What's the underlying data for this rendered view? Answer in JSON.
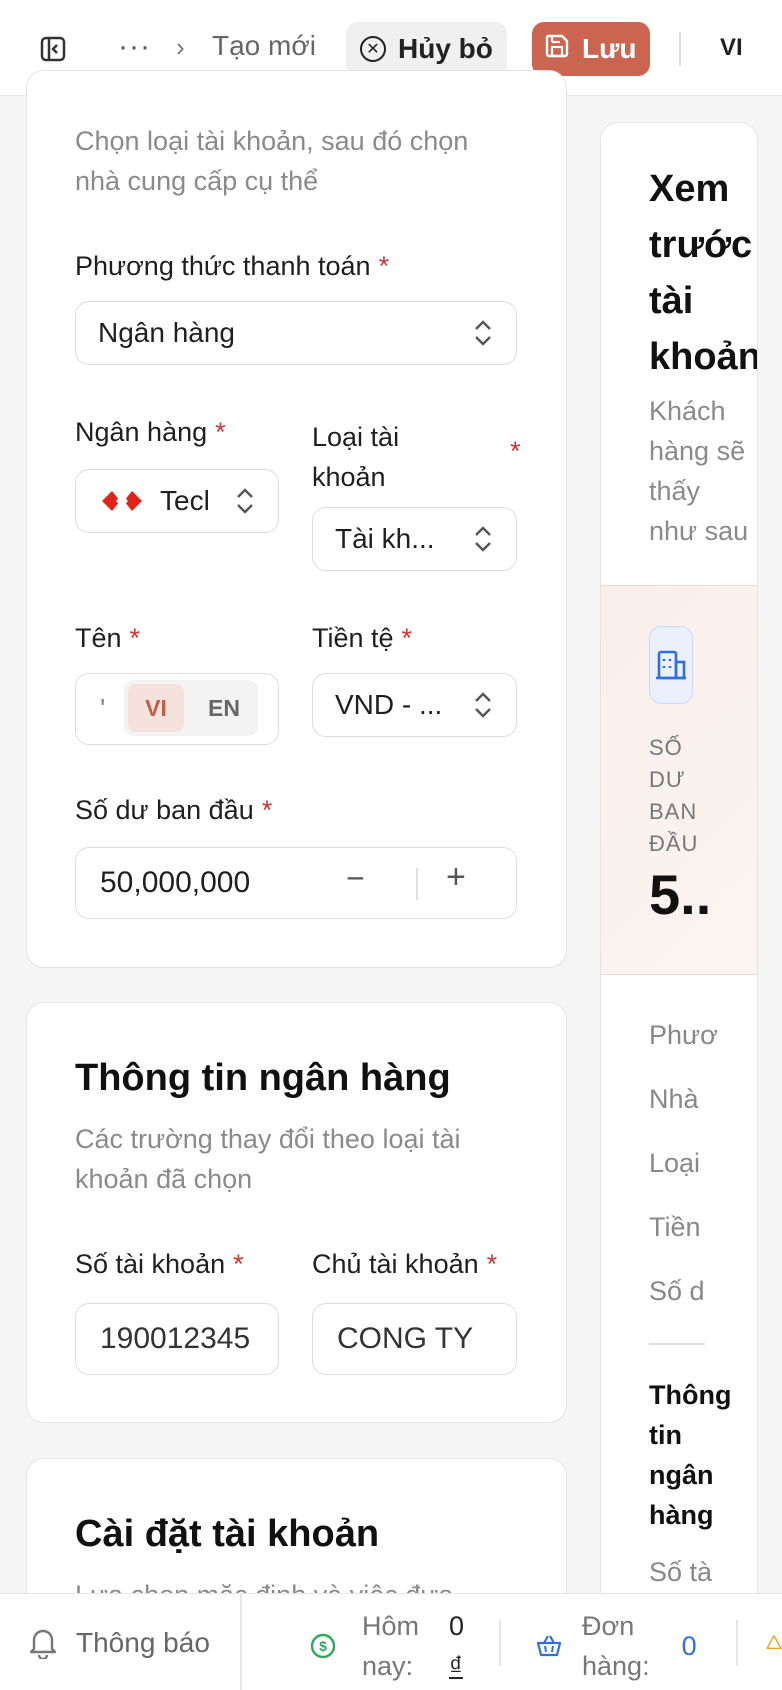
{
  "topbar": {
    "more_label": "···",
    "breadcrumb_current": "Tạo mới",
    "cancel_label": "Hủy bỏ",
    "save_label": "Lưu",
    "language": "VI",
    "save_color": "#cc6550"
  },
  "account_type_card": {
    "description": "Chọn loại tài khoản, sau đó chọn nhà cung cấp cụ thể",
    "payment_method": {
      "label": "Phương thức thanh toán",
      "value": "Ngân hàng"
    },
    "bank": {
      "label": "Ngân hàng",
      "value": "Tecl",
      "logo": "techcombank-logo"
    },
    "account_kind": {
      "label_line1": "Loại tài",
      "label_line2": "khoản",
      "value": "Tài kh..."
    },
    "name": {
      "label": "Tên",
      "value": "'",
      "lang_options": [
        "VI",
        "EN"
      ],
      "lang_selected": "VI"
    },
    "currency": {
      "label": "Tiền tệ",
      "value": "VND - ..."
    },
    "opening_balance": {
      "label": "Số dư ban đầu",
      "value": "50,000,000",
      "minus": "−",
      "plus": "+"
    },
    "required_mark": "*"
  },
  "bank_info_card": {
    "title": "Thông tin ngân hàng",
    "description": "Các trường thay đổi theo loại tài khoản đã chọn",
    "account_number": {
      "label": "Số tài khoản",
      "value": "190012345"
    },
    "account_holder": {
      "label": "Chủ tài khoản",
      "value": "CONG TY"
    }
  },
  "settings_card": {
    "title": "Cài đặt tài khoản",
    "description": "Lựa chọn mặc định và việc đưa"
  },
  "preview": {
    "title_lines": [
      "Xem",
      "trước",
      "tài",
      "khoản"
    ],
    "subtitle_lines": [
      "Khách",
      "hàng sẽ",
      "thấy",
      "như sau"
    ],
    "balance_label_lines": [
      "SỐ",
      "DƯ",
      "BAN",
      "ĐẦU"
    ],
    "balance_value": "5..",
    "rows": [
      "Phươ",
      "Nhà",
      "Loại",
      "Tiền",
      "Số d"
    ],
    "bank_section_lines": [
      "Thông",
      "tin",
      "ngân",
      "hàng"
    ],
    "bank_section_row": "Số tà"
  },
  "bottombar": {
    "notifications_label": "Thông báo",
    "today_label_line1": "Hôm",
    "today_label_line2": "nay:",
    "today_value_line1": "0",
    "today_value_line2": "₫",
    "orders_label_line1": "Đơn",
    "orders_label_line2": "hàng:",
    "orders_value": "0",
    "accent_blue": "#2f6fe0",
    "accent_green": "#2eaa5a"
  }
}
